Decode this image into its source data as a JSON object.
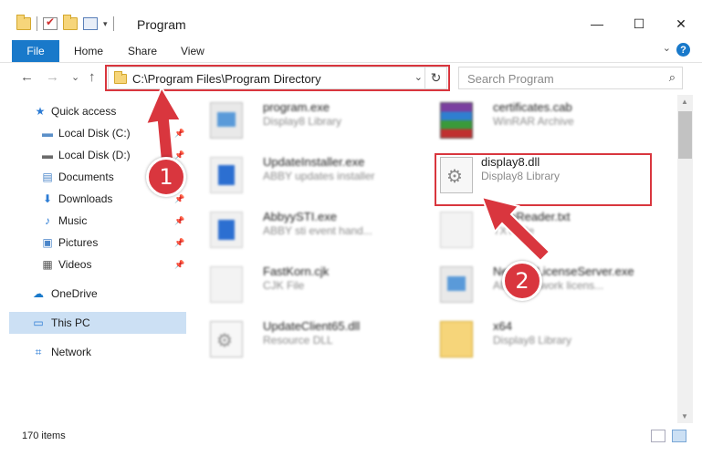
{
  "window": {
    "title": "Program",
    "minimize_glyph": "—",
    "maximize_glyph": "☐",
    "close_glyph": "✕"
  },
  "ribbon": {
    "tabs": [
      "File",
      "Home",
      "Share",
      "View"
    ],
    "expand_glyph": "⌄",
    "help_glyph": "?"
  },
  "nav": {
    "back_glyph": "←",
    "forward_glyph": "→",
    "recent_glyph": "⌄",
    "up_glyph": "↑",
    "address": "C:\\Program Files\\Program Directory",
    "refresh_glyph": "↻",
    "search_placeholder": "Search Program",
    "search_glyph": "⌕"
  },
  "sidebar": {
    "items": [
      {
        "label": "Quick access",
        "icon": "star-icon",
        "glyph": "★",
        "color": "#2b7bd4",
        "pinned": false
      },
      {
        "label": "Local Disk (C:)",
        "icon": "drive-icon",
        "glyph": "▬",
        "color": "#5a8fc8",
        "pinned": true
      },
      {
        "label": "Local Disk (D:)",
        "icon": "drive-icon",
        "glyph": "▬",
        "color": "#6a6a6a",
        "pinned": true
      },
      {
        "label": "Documents",
        "icon": "documents-icon",
        "glyph": "▤",
        "color": "#4b86c9",
        "pinned": true
      },
      {
        "label": "Downloads",
        "icon": "downloads-icon",
        "glyph": "⬇",
        "color": "#2b7bd4",
        "pinned": true
      },
      {
        "label": "Music",
        "icon": "music-icon",
        "glyph": "♪",
        "color": "#2b7bd4",
        "pinned": true
      },
      {
        "label": "Pictures",
        "icon": "pictures-icon",
        "glyph": "▣",
        "color": "#4b86c9",
        "pinned": true
      },
      {
        "label": "Videos",
        "icon": "videos-icon",
        "glyph": "▦",
        "color": "#555555",
        "pinned": true
      },
      {
        "label": "OneDrive",
        "icon": "cloud-icon",
        "glyph": "☁",
        "color": "#1979ca",
        "pinned": false
      },
      {
        "label": "This PC",
        "icon": "computer-icon",
        "glyph": "▭",
        "color": "#2b7bd4",
        "pinned": false
      },
      {
        "label": "Network",
        "icon": "network-icon",
        "glyph": "⌗",
        "color": "#2b7bd4",
        "pinned": false
      }
    ],
    "pin_glyph": "📌"
  },
  "files": [
    {
      "name": "program.exe",
      "desc": "Display8 Library",
      "icon": "installer-icon"
    },
    {
      "name": "certificates.cab",
      "desc": "WinRAR Archive",
      "icon": "archive-icon"
    },
    {
      "name": "UpdateInstaller.exe",
      "desc": "ABBY updates installer",
      "icon": "window-icon"
    },
    {
      "name": "display8.dll",
      "desc": "Display8 Library",
      "icon": "dll-gear-icon"
    },
    {
      "name": "AbbyySTI.exe",
      "desc": "ABBY sti event hand...",
      "icon": "window-icon"
    },
    {
      "name": "FineReader.txt",
      "desc": "TXT File",
      "icon": "text-file-icon"
    },
    {
      "name": "FastKorn.cjk",
      "desc": "CJK File",
      "icon": "blank-file-icon"
    },
    {
      "name": "NetworkLicenseServer.exe",
      "desc": "ABBY network licens...",
      "icon": "exe-icon"
    },
    {
      "name": "UpdateClient65.dll",
      "desc": "Resource DLL",
      "icon": "dll-gear-icon"
    },
    {
      "name": "x64",
      "desc": "Display8 Library",
      "icon": "folder-icon"
    }
  ],
  "status": {
    "item_count": "170 items"
  },
  "annotations": {
    "badge_1": "1",
    "badge_2": "2",
    "color": "#d9363e"
  },
  "scrollbar": {
    "up_glyph": "▲",
    "down_glyph": "▼"
  }
}
